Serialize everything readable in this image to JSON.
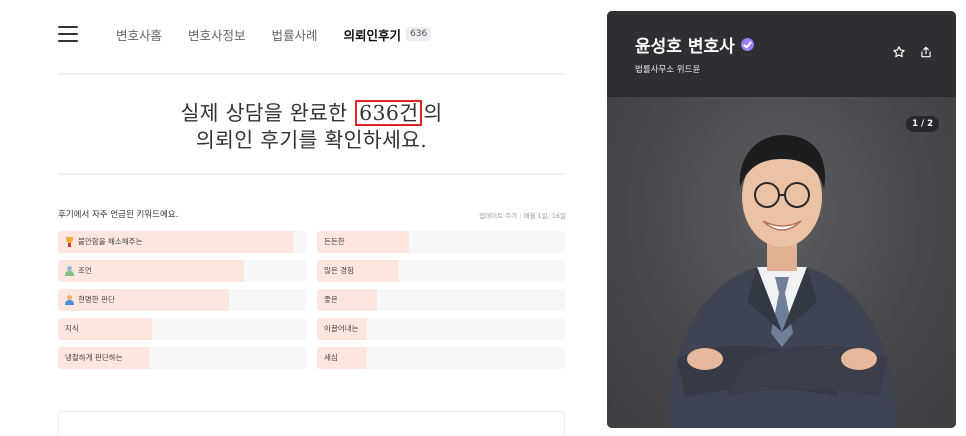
{
  "nav": {
    "items": [
      "변호사홈",
      "변호사정보",
      "법률사례"
    ],
    "active_label": "의뢰인후기",
    "active_count": "636"
  },
  "headline": {
    "line1_before": "실제 상담을 완료한 ",
    "highlight": "636건",
    "line1_after": "의",
    "line2": "의뢰인 후기를 확인하세요."
  },
  "keywords": {
    "title": "후기에서 자주 언급된 키워드에요.",
    "update_note": "업데이트 주기 : 매월 1일, 16일",
    "left": [
      {
        "label": "불안함을 해소해주는",
        "fill": 0.95,
        "icon": "trophy-gold"
      },
      {
        "label": "조언",
        "fill": 0.75,
        "icon": "person-silver"
      },
      {
        "label": "현명한 판단",
        "fill": 0.69,
        "icon": "person-bronze"
      },
      {
        "label": "지식",
        "fill": 0.38,
        "icon": ""
      },
      {
        "label": "냉철하게 판단하는",
        "fill": 0.37,
        "icon": ""
      }
    ],
    "right": [
      {
        "label": "든든한",
        "fill": 0.37
      },
      {
        "label": "많은 경험",
        "fill": 0.33
      },
      {
        "label": "좋은",
        "fill": 0.24
      },
      {
        "label": "이끌어내는",
        "fill": 0.2
      },
      {
        "label": "세심",
        "fill": 0.2
      }
    ]
  },
  "profile": {
    "name": "윤성호 변호사",
    "firm": "법률사무소 위드윤",
    "photo_counter": "1 / 2",
    "icons": [
      "star-icon",
      "share-icon",
      "verified-badge-icon"
    ]
  },
  "colors": {
    "bar_fill": "#fde6dd",
    "bar_track": "#f6f7f9",
    "highlight_box": "#e02424",
    "profile_header": "#2d2f33",
    "verified": "#9b7cf3"
  }
}
